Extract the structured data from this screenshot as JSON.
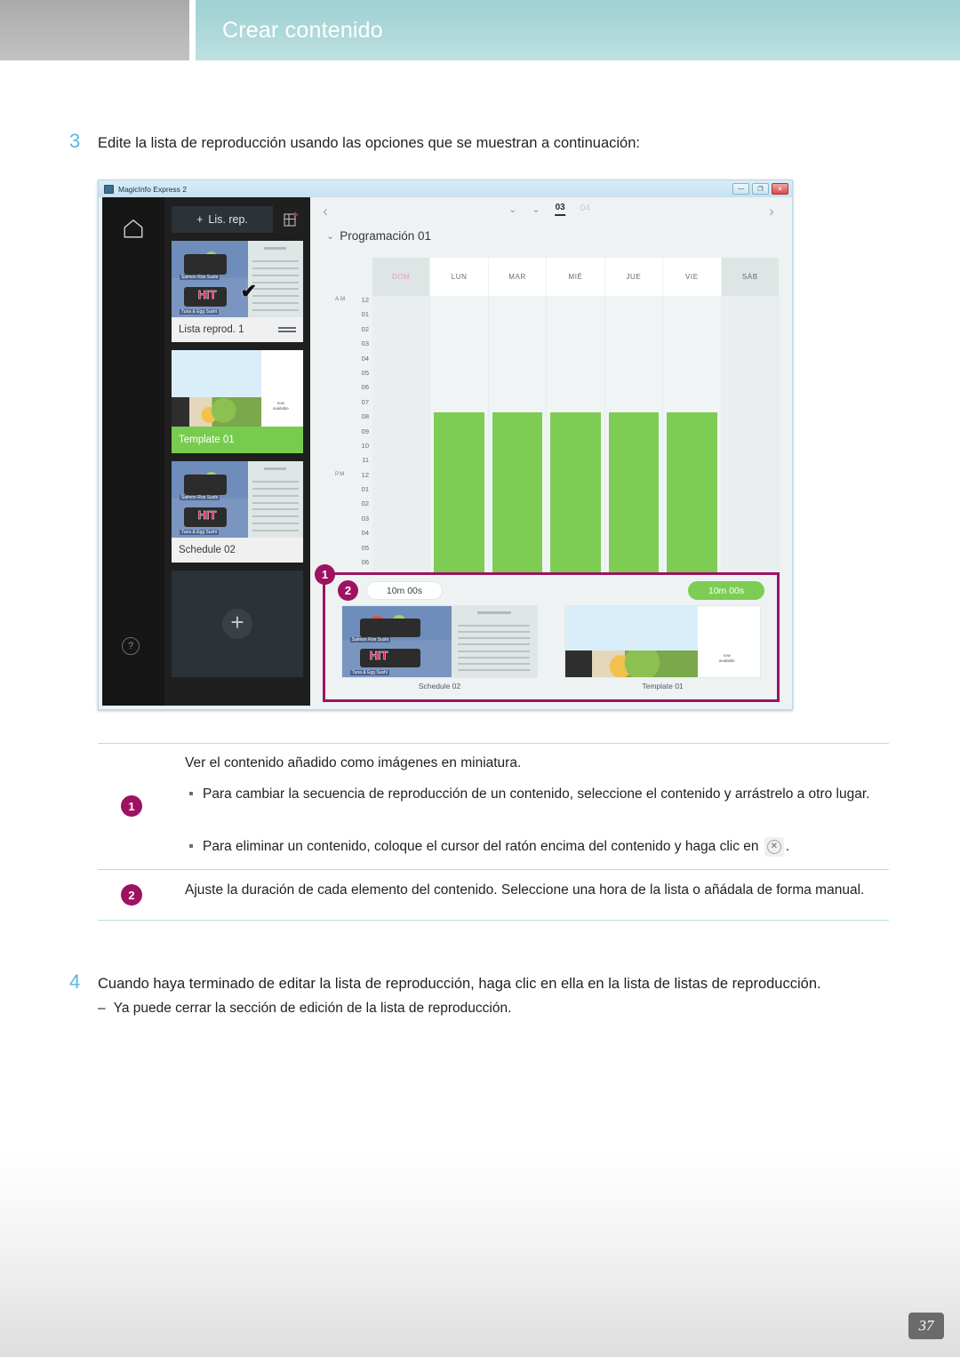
{
  "header": {
    "title": "Crear contenido",
    "teal_color": "#a9d6d7",
    "gray_color": "#b8b8b8"
  },
  "steps": {
    "step3": {
      "number": "3",
      "text": "Edite la lista de reproducción usando las opciones que se muestran a continuación:"
    },
    "step4": {
      "number": "4",
      "text": "Cuando haya terminado de editar la lista de reproducción, haga clic en ella en la lista de listas de reproducción.",
      "dash": "–",
      "sub_text": "Ya puede cerrar la sección de edición de la lista de reproducción."
    }
  },
  "notes": {
    "badge1": "1",
    "badge2": "2",
    "lead": "Ver el contenido añadido como imágenes en miniatura.",
    "bullet1": "Para cambiar la secuencia de reproducción de un contenido, seleccione el contenido y arrástrelo a otro lugar.",
    "bullet2_pre": "Para eliminar un contenido, coloque el cursor del ratón encima del contenido y haga clic en",
    "bullet2_icon": "✕",
    "bullet2_post": ".",
    "note2": "Ajuste la duración de cada elemento del contenido. Seleccione una hora de la lista o añádala de forma manual.",
    "badge_color": "#9e1261"
  },
  "app": {
    "title_bar": {
      "app_name": "MagicInfo Express 2",
      "minimize": "—",
      "maximize": "❐",
      "close": "✕"
    },
    "rail": {
      "home_icon": "home-icon",
      "help_icon": "?"
    },
    "playlist_panel": {
      "add_playlist_label": "Lis. rep.",
      "add_playlist_plus": "+",
      "new_template_icon": "new-template-icon",
      "items": [
        {
          "name": "Lista reprod. 1",
          "selected": true,
          "highlight": false,
          "art": "sushi"
        },
        {
          "name": "Template 01",
          "selected": false,
          "highlight": true,
          "art": "template"
        },
        {
          "name": "Schedule 02",
          "selected": false,
          "highlight": false,
          "art": "sushi"
        }
      ],
      "add_tile_plus": "+",
      "check_mark": "✔"
    },
    "schedule": {
      "prev_arrow": "‹",
      "next_arrow": "›",
      "tab_chevron": "⌄",
      "tabs": [
        {
          "label": "03",
          "active": true
        },
        {
          "label": "04",
          "active": false
        }
      ],
      "title": "Programación 01",
      "title_chevron": "⌄",
      "meridiem_am": "A.M",
      "meridiem_pm": "P.M",
      "hours": [
        "12",
        "01",
        "02",
        "03",
        "04",
        "05",
        "06",
        "07",
        "08",
        "09",
        "10",
        "11",
        "12",
        "01",
        "02",
        "03",
        "04",
        "05",
        "06"
      ],
      "days": [
        {
          "label": "DOM",
          "weekend": true
        },
        {
          "label": "LUN",
          "weekend": false
        },
        {
          "label": "MAR",
          "weekend": false
        },
        {
          "label": "MIÉ",
          "weekend": false
        },
        {
          "label": "JUE",
          "weekend": false
        },
        {
          "label": "VIE",
          "weekend": false
        },
        {
          "label": "SÁB",
          "weekend": true
        }
      ],
      "event_color": "#7dcc54",
      "event_days": [
        "LUN",
        "MAR",
        "MIÉ",
        "JUE",
        "VIE"
      ],
      "event_start_hour": "08 A.M"
    },
    "strip": {
      "callout_color": "#9e1261",
      "badge1": "1",
      "badge2": "2",
      "duration_left": "10m 00s",
      "duration_right": "10m 00s",
      "items": [
        {
          "name": "Schedule 02",
          "art": "sushi"
        },
        {
          "name": "Template 01",
          "art": "template"
        }
      ]
    }
  },
  "page_number": "37"
}
